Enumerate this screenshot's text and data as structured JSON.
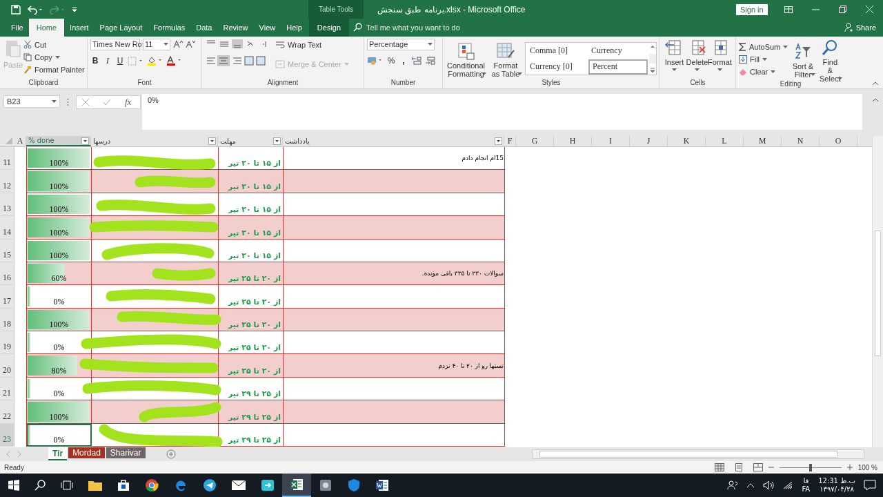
{
  "title_bar": {
    "document_title": "برنامه طبق سنجش.xlsx  -  Microsoft Office",
    "contextual_label": "Table Tools",
    "sign_in": "Sign in"
  },
  "tabs": [
    {
      "label": "File",
      "selected": false,
      "kind": "plain"
    },
    {
      "label": "Home",
      "selected": true,
      "kind": "plain"
    },
    {
      "label": "Insert",
      "selected": false,
      "kind": "plain"
    },
    {
      "label": "Page Layout",
      "selected": false,
      "kind": "plain"
    },
    {
      "label": "Formulas",
      "selected": false,
      "kind": "plain"
    },
    {
      "label": "Data",
      "selected": false,
      "kind": "plain"
    },
    {
      "label": "Review",
      "selected": false,
      "kind": "plain"
    },
    {
      "label": "View",
      "selected": false,
      "kind": "plain"
    },
    {
      "label": "Help",
      "selected": false,
      "kind": "plain"
    },
    {
      "label": "Design",
      "selected": false,
      "kind": "contextual"
    }
  ],
  "tell_me": {
    "placeholder": "Tell me what you want to do"
  },
  "share": "Share",
  "ribbon": {
    "clipboard": {
      "label": "Clipboard",
      "paste": "Paste",
      "cut": "Cut",
      "copy": "Copy",
      "format_painter": "Format Painter"
    },
    "font": {
      "label": "Font",
      "family": "Times New Ro",
      "size": "11",
      "bold": "B",
      "italic": "I",
      "underline": "U"
    },
    "alignment": {
      "label": "Alignment",
      "wrap_text": "Wrap Text",
      "merge_center": "Merge & Center"
    },
    "number": {
      "label": "Number",
      "format": "Percentage",
      "percent": "%",
      "comma": ","
    },
    "styles": {
      "label": "Styles",
      "conditional": "Conditional Formatting",
      "format_table": "Format as Table",
      "cell_styles": [
        {
          "label": "Comma [0]",
          "selected": false
        },
        {
          "label": "Currency",
          "selected": false
        },
        {
          "label": "Currency [0]",
          "selected": false
        },
        {
          "label": "Percent",
          "selected": true
        }
      ]
    },
    "cells": {
      "label": "Cells",
      "buttons": [
        "Insert",
        "Delete",
        "Format"
      ]
    },
    "editing": {
      "label": "Editing",
      "autosum": "AutoSum",
      "fill": "Fill",
      "clear": "Clear",
      "sort": "Sort & Filter",
      "find": "Find & Select"
    }
  },
  "formula_bar": {
    "name_box": "B23",
    "fx": "fx",
    "value": "0%"
  },
  "columns": [
    {
      "label": "A",
      "kind": "letter",
      "selected": false
    },
    {
      "label": "% done",
      "kind": "table",
      "selected": true
    },
    {
      "label": "درسها",
      "kind": "table",
      "selected": false
    },
    {
      "label": "مهلت",
      "kind": "table",
      "selected": false
    },
    {
      "label": "یادداشت",
      "kind": "table",
      "selected": false
    },
    {
      "label": "F",
      "kind": "letter",
      "selected": false
    },
    {
      "label": "G",
      "kind": "letter",
      "selected": false
    },
    {
      "label": "H",
      "kind": "letter",
      "selected": false
    },
    {
      "label": "I",
      "kind": "letter",
      "selected": false
    },
    {
      "label": "J",
      "kind": "letter",
      "selected": false
    },
    {
      "label": "K",
      "kind": "letter",
      "selected": false
    },
    {
      "label": "L",
      "kind": "letter",
      "selected": false
    },
    {
      "label": "M",
      "kind": "letter",
      "selected": false
    },
    {
      "label": "N",
      "kind": "letter",
      "selected": false
    },
    {
      "label": "O",
      "kind": "letter",
      "selected": false
    }
  ],
  "rows": [
    {
      "number": "11",
      "done": "100%",
      "level": 1,
      "deadline": "از ۱۵ تا ۲۰ تیر",
      "note": "15ام انجام دادم",
      "banded": false,
      "scribbled": true,
      "selected": false
    },
    {
      "number": "12",
      "done": "100%",
      "level": 1,
      "deadline": "از ۱۵ تا ۲۰ تیر",
      "banded": true,
      "scribbled": true,
      "selected": false
    },
    {
      "number": "13",
      "done": "100%",
      "level": 1,
      "deadline": "از ۱۵ تا ۲۰ تیر",
      "banded": false,
      "scribbled": true,
      "selected": false
    },
    {
      "number": "14",
      "done": "100%",
      "level": 1,
      "deadline": "از ۱۵ تا ۲۰ تیر",
      "banded": true,
      "scribbled": true,
      "selected": false
    },
    {
      "number": "15",
      "done": "100%",
      "level": 1,
      "deadline": "از ۱۵ تا ۲۰ تیر",
      "banded": false,
      "scribbled": true,
      "selected": false
    },
    {
      "number": "16",
      "done": "60%",
      "level": 0.6,
      "deadline": "از ۲۰ تا ۲۵ تیر",
      "note": "سوالات ۳۳۰ تا ۳۳۵ باقی مونده.",
      "banded": true,
      "scribbled": true,
      "selected": false
    },
    {
      "number": "17",
      "done": "0%",
      "level": 0,
      "deadline": "از ۲۰ تا ۲۵ تیر",
      "banded": false,
      "scribbled": true,
      "selected": false
    },
    {
      "number": "18",
      "done": "100%",
      "level": 1,
      "deadline": "از ۲۰ تا ۲۵ تیر",
      "banded": true,
      "scribbled": true,
      "selected": false
    },
    {
      "number": "19",
      "done": "0%",
      "level": 0,
      "deadline": "از ۲۰ تا ۲۵ تیر",
      "banded": false,
      "scribbled": true,
      "selected": false
    },
    {
      "number": "20",
      "done": "80%",
      "level": 0.8,
      "deadline": "از ۲۰ تا ۲۵ تیر",
      "note": "تستها رو از ۲۰ تا ۴۰ نزدم",
      "banded": true,
      "scribbled": true,
      "selected": false
    },
    {
      "number": "21",
      "done": "0%",
      "level": 0,
      "deadline": "از ۲۵ تا ۲۹ تیر",
      "banded": false,
      "scribbled": true,
      "selected": false
    },
    {
      "number": "22",
      "done": "100%",
      "level": 1,
      "deadline": "از ۲۵ تا ۲۹ تیر",
      "banded": true,
      "scribbled": true,
      "selected": false
    },
    {
      "number": "23",
      "done": "0%",
      "level": 0,
      "deadline": "از ۲۵ تا ۲۹ تیر",
      "banded": false,
      "scribbled": true,
      "selected": true
    }
  ],
  "sheet_tabs": [
    {
      "label": "Tir",
      "selected": true
    },
    {
      "label": "Mordad",
      "selected": false,
      "color": "#a5301f"
    },
    {
      "label": "Sharivar",
      "selected": false,
      "color": "#6e6567"
    }
  ],
  "status_bar": {
    "status": "Ready",
    "zoom": {
      "label": "100 %",
      "level": 0.5
    }
  },
  "taskbar": {
    "language_top": "فا",
    "language": "FA",
    "time": "12:31 ب.ظ",
    "date": "۱۳۹۷/۰۴/۲۸"
  }
}
